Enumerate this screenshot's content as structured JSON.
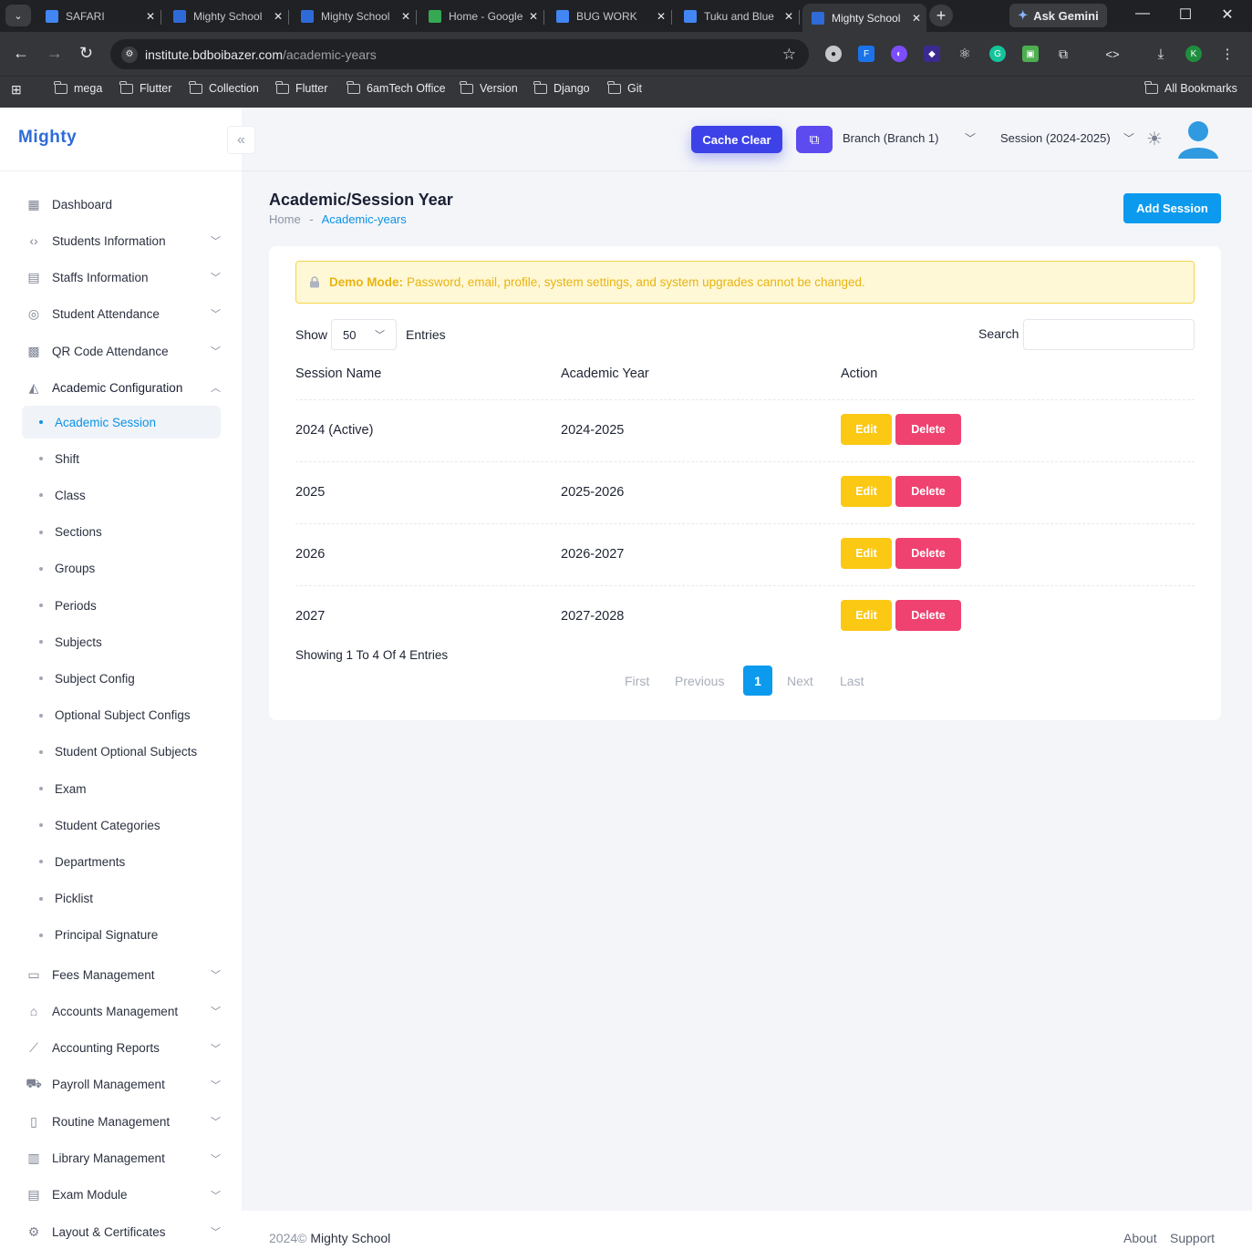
{
  "browser": {
    "tabs": [
      {
        "title": "SAFARI",
        "favicon_color": "#4285f4"
      },
      {
        "title": "Mighty School",
        "favicon_color": "#2e6bd8"
      },
      {
        "title": "Mighty School",
        "favicon_color": "#2e6bd8"
      },
      {
        "title": "Home - Google Drive",
        "favicon_color": "#34a853"
      },
      {
        "title": "BUG WORK",
        "favicon_color": "#4285f4"
      },
      {
        "title": "Tuku and Blue",
        "favicon_color": "#4285f4"
      },
      {
        "title": "Mighty School",
        "favicon_color": "#2e6bd8"
      }
    ],
    "ask_gemini": "Ask Gemini",
    "url_host": "institute.bdboibazer.com",
    "url_path": "/academic-years",
    "bookmarks": [
      "mega",
      "Flutter",
      "Collection",
      "Flutter",
      "6amTech Office",
      "Version",
      "Django",
      "Git"
    ],
    "all_bookmarks": "All Bookmarks",
    "profile_initial": "K"
  },
  "app": {
    "logo_text": "Mighty",
    "cache_clear": "Cache Clear",
    "branch": "Branch (Branch 1)",
    "session": "Session (2024-2025)"
  },
  "sidebar": {
    "top_items": [
      {
        "label": "Dashboard",
        "icon": "dashboard-icon",
        "chevron": false
      },
      {
        "label": "Students Information",
        "icon": "code-icon",
        "chevron": true
      },
      {
        "label": "Staffs Information",
        "icon": "id-card-icon",
        "chevron": true
      },
      {
        "label": "Student Attendance",
        "icon": "fingerprint-icon",
        "chevron": true
      },
      {
        "label": "QR Code Attendance",
        "icon": "qr-code-icon",
        "chevron": true
      },
      {
        "label": "Academic Configuration",
        "icon": "academic-icon",
        "chevron": true
      }
    ],
    "sub_items": [
      "Academic Session",
      "Shift",
      "Class",
      "Sections",
      "Groups",
      "Periods",
      "Subjects",
      "Subject Config",
      "Optional Subject Configs",
      "Student Optional Subjects",
      "Exam",
      "Student Categories",
      "Departments",
      "Picklist",
      "Principal Signature"
    ],
    "bottom_items": [
      {
        "label": "Fees Management",
        "icon": "money-icon"
      },
      {
        "label": "Accounts Management",
        "icon": "bank-icon"
      },
      {
        "label": "Accounting Reports",
        "icon": "chart-icon"
      },
      {
        "label": "Payroll Management",
        "icon": "payroll-icon"
      },
      {
        "label": "Routine Management",
        "icon": "book-icon"
      },
      {
        "label": "Library Management",
        "icon": "library-icon"
      },
      {
        "label": "Exam Module",
        "icon": "layout-icon"
      },
      {
        "label": "Layout & Certificates",
        "icon": "gear-icon"
      }
    ]
  },
  "page": {
    "title": "Academic/Session Year",
    "breadcrumb_home": "Home",
    "breadcrumb_sep": "-",
    "breadcrumb_current": "Academic-years",
    "add_button": "Add Session"
  },
  "demo_notice": {
    "label": "Demo Mode:",
    "text": "Password, email, profile, system settings, and system upgrades cannot be changed."
  },
  "table": {
    "show_label": "Show",
    "per_page": "50",
    "entries_label": "Entries",
    "search_label": "Search",
    "search_value": "",
    "columns": [
      "Session Name",
      "Academic Year",
      "Action"
    ],
    "rows": [
      {
        "session_name": "2024 (Active)",
        "academic_year": "2024-2025"
      },
      {
        "session_name": "2025",
        "academic_year": "2025-2026"
      },
      {
        "session_name": "2026",
        "academic_year": "2026-2027"
      },
      {
        "session_name": "2027",
        "academic_year": "2027-2028"
      }
    ],
    "edit_label": "Edit",
    "delete_label": "Delete",
    "showing_text": "Showing 1 To 4 Of 4 Entries",
    "pagination": {
      "first": "First",
      "previous": "Previous",
      "current": "1",
      "next": "Next",
      "last": "Last"
    }
  },
  "footer": {
    "year": "2024©",
    "brand": "Mighty School",
    "links": [
      "About",
      "Support"
    ]
  },
  "colors": {
    "primary": "#0b9aee",
    "edit": "#fbc814",
    "delete": "#ef4270",
    "cache": "#3d42e8"
  }
}
